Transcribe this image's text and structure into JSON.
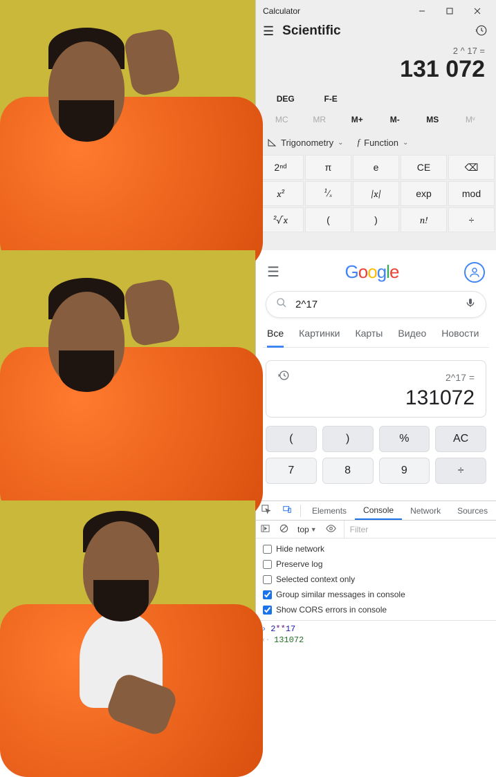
{
  "calc": {
    "title": "Calculator",
    "mode": "Scientific",
    "expression": "2 ^ 17 =",
    "result": "131 072",
    "row1": {
      "deg": "DEG",
      "fe": "F-E"
    },
    "mem": {
      "mc": "MC",
      "mr": "MR",
      "mplus": "M+",
      "mminus": "M-",
      "ms": "MS",
      "mlist": "Mᵛ"
    },
    "drops": {
      "trig": "Trigonometry",
      "func": "Function"
    },
    "keys": {
      "r1": [
        "2ⁿᵈ",
        "π",
        "e",
        "CE",
        "⌫"
      ],
      "r2": [
        "x²",
        "¹⁄ₓ",
        "|x|",
        "exp",
        "mod"
      ],
      "r3": [
        "²√x",
        "(",
        ")",
        "n!",
        "÷"
      ]
    }
  },
  "google": {
    "logo_parts": [
      "G",
      "o",
      "o",
      "g",
      "l",
      "e"
    ],
    "query": "2^17",
    "tabs": [
      "Все",
      "Картинки",
      "Карты",
      "Видео",
      "Новости"
    ],
    "calc_expr": "2^17 =",
    "calc_result": "131072",
    "keys_r1": [
      "(",
      ")",
      "%",
      "AC"
    ],
    "keys_r2": [
      "7",
      "8",
      "9",
      "÷"
    ]
  },
  "devtools": {
    "tabs": [
      "Elements",
      "Console",
      "Network",
      "Sources"
    ],
    "context": "top",
    "filter_placeholder": "Filter",
    "options": [
      {
        "label": "Hide network",
        "checked": false
      },
      {
        "label": "Preserve log",
        "checked": false
      },
      {
        "label": "Selected context only",
        "checked": false
      },
      {
        "label": "Group similar messages in console",
        "checked": true
      },
      {
        "label": "Show CORS errors in console",
        "checked": true
      }
    ],
    "input_parts": {
      "a": "2",
      "op": "**",
      "b": "17"
    },
    "output": "131072"
  }
}
